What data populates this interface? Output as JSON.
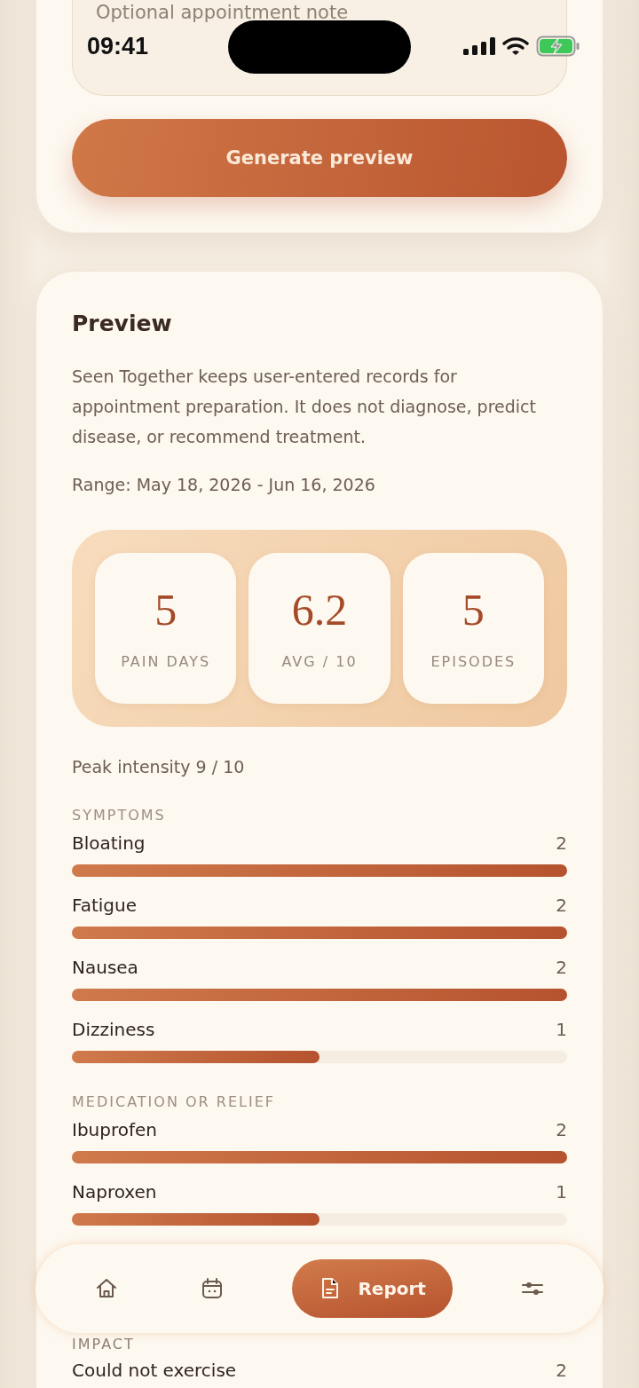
{
  "status_bar": {
    "time": "09:41"
  },
  "note_field": {
    "placeholder": "Optional appointment note"
  },
  "generate_button": {
    "label": "Generate preview"
  },
  "preview": {
    "title": "Preview",
    "disclaimer": "Seen Together keeps user-entered records for appointment preparation. It does not diagnose, predict disease, or recommend treatment.",
    "range": "Range: May 18, 2026 - Jun 16, 2026",
    "stats": [
      {
        "value": "5",
        "label": "PAIN DAYS"
      },
      {
        "value": "6.2",
        "label": "AVG / 10"
      },
      {
        "value": "5",
        "label": "EPISODES"
      }
    ],
    "peak": "Peak intensity 9 / 10",
    "sections": [
      {
        "heading": "SYMPTOMS",
        "items": [
          {
            "name": "Bloating",
            "count": "2",
            "level": 1
          },
          {
            "name": "Fatigue",
            "count": "2",
            "level": 1
          },
          {
            "name": "Nausea",
            "count": "2",
            "level": 1
          },
          {
            "name": "Dizziness",
            "count": "1",
            "level": 0.5
          }
        ]
      },
      {
        "heading": "MEDICATION OR RELIEF",
        "items": [
          {
            "name": "Ibuprofen",
            "count": "2",
            "level": 1
          },
          {
            "name": "Naproxen",
            "count": "1",
            "level": 0.5
          }
        ]
      },
      {
        "heading": "IMPACT",
        "items": [
          {
            "name": "Could not exercise",
            "count": "2"
          }
        ]
      }
    ]
  },
  "nav": [
    {
      "kind": "home",
      "selected": false
    },
    {
      "kind": "calendar",
      "selected": false
    },
    {
      "kind": "report",
      "label": "Report",
      "selected": true
    },
    {
      "kind": "settings",
      "selected": false
    }
  ]
}
